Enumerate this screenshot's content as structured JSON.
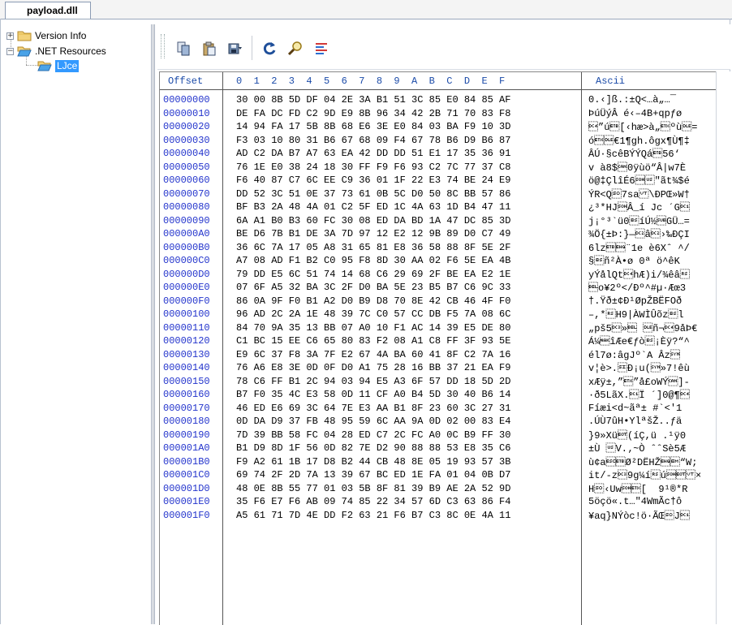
{
  "tab": {
    "title": "payload.dll"
  },
  "tree": {
    "items": [
      {
        "label": "Version Info",
        "expander": "+"
      },
      {
        "label": ".NET Resources",
        "expander": "−"
      },
      {
        "label": "LJce",
        "selected": true
      }
    ]
  },
  "toolbar": {
    "buttons": [
      "copy-icon",
      "paste-icon",
      "save-to-file-icon",
      "refresh-icon",
      "find-icon",
      "properties-icon"
    ]
  },
  "hex": {
    "header_offset": "Offset",
    "header_columns": "0  1  2  3  4  5  6  7  8  9  A  B  C  D  E  F",
    "header_ascii": "Ascii",
    "rows": [
      {
        "offset": "00000000",
        "bytes": "30 00 8B 5D DF 04 2E 3A B1 51 3C 85 E0 84 85 AF",
        "ascii": "0.‹]ß.:±Q<…à„…¯"
      },
      {
        "offset": "00000010",
        "bytes": "DE FA DC FD C2 9D E9 8B 96 34 42 2B 71 70 83 F8",
        "ascii": "ÞúÜýÂ é‹–4B+qpƒø"
      },
      {
        "offset": "00000020",
        "bytes": "14 94 FA 17 5B 8B 68 E6 3E E0 84 03 BA F9 10 3D",
        "ascii": "\u0014”ú\u0017[‹hæ>à„\u0003ºù\u0010="
      },
      {
        "offset": "00000030",
        "bytes": "F3 03 10 80 31 B6 67 68 09 F4 67 78 B6 D9 B6 87",
        "ascii": "ó\u0003\u0010€1¶gh.ôgx¶Ù¶‡"
      },
      {
        "offset": "00000040",
        "bytes": "AD C2 DA B7 A7 63 EA 42 DD DD 51 E1 17 35 36 91",
        "ascii": "­ÂÚ·§cêBÝÝQá\u001756‘"
      },
      {
        "offset": "00000050",
        "bytes": "76 1E E0 38 24 18 30 FF F9 F6 93 C2 7C 77 37 C8",
        "ascii": "v à8$\u00180ÿùö“Â|w7È"
      },
      {
        "offset": "00000060",
        "bytes": "F6 40 87 C7 6C EE C9 36 01 1F 22 E3 74 BE 24 E9",
        "ascii": "ö@‡ÇlîÉ6\u0001\u001f\"ãt¾$é"
      },
      {
        "offset": "00000070",
        "bytes": "DD 52 3C 51 0E 37 73 61 0B 5C D0 50 8C BB 57 86",
        "ascii": "ÝR<Q\u000e7sa\u000b\\ÐPŒ»W†"
      },
      {
        "offset": "00000080",
        "bytes": "BF B3 2A 48 4A 01 C2 5F ED 1C 4A 63 1D B4 47 11",
        "ascii": "¿³*HJ\u0001Â_í Jc ´G\u0011"
      },
      {
        "offset": "00000090",
        "bytes": "6A A1 B0 B3 60 FC 30 08 ED DA BD 1A 47 DC 85 3D",
        "ascii": "j¡°³`ü0\bíÚ½\u001aGÜ…="
      },
      {
        "offset": "000000A0",
        "bytes": "BE D6 7B B1 DE 3A 7D 97 12 E2 12 9B 89 D0 C7 49",
        "ascii": "¾Ö{±Þ:}—\u0012â\u0012›‰ÐÇI"
      },
      {
        "offset": "000000B0",
        "bytes": "36 6C 7A 17 05 A8 31 65 81 E8 36 58 88 8F 5E 2F",
        "ascii": "6lz\u0017\u0005¨1e è6Xˆ ^/"
      },
      {
        "offset": "000000C0",
        "bytes": "A7 08 AD F1 B2 C0 95 F8 8D 30 AA 02 F6 5E EA 4B",
        "ascii": "§\b­ñ²À•ø 0ª ö^êK"
      },
      {
        "offset": "000000D0",
        "bytes": "79 DD E5 6C 51 74 14 68 C6 29 69 2F BE EA E2 1E",
        "ascii": "yÝålQt\u0014hÆ)i/¾êâ\u001e"
      },
      {
        "offset": "000000E0",
        "bytes": "07 6F A5 32 BA 3C 2F D0 BA 5E 23 B5 B7 C6 9C 33",
        "ascii": "\u0007o¥2º</Ðº^#µ·Æœ3"
      },
      {
        "offset": "000000F0",
        "bytes": "86 0A 9F F0 B1 A2 D0 B9 D8 70 8E 42 CB 46 4F F0",
        "ascii": "†.Ÿð±¢Ð¹ØpŽBËFOð"
      },
      {
        "offset": "00000100",
        "bytes": "96 AD 2C 2A 1E 48 39 7C C0 57 CC DB F5 7A 08 6C",
        "ascii": "–­,*\u001eH9|ÀWÌÛõz\bl"
      },
      {
        "offset": "00000110",
        "bytes": "84 70 9A 35 13 BB 07 A0 10 F1 AC 14 39 E5 DE 80",
        "ascii": "„pš5\u0013»\u0007 \u0010ñ¬\u00149åÞ€"
      },
      {
        "offset": "00000120",
        "bytes": "C1 BC 15 EE C6 65 80 83 F2 08 A1 C8 FF 3F 93 5E",
        "ascii": "Á¼\u0015îÆe€ƒò\b¡Èÿ?“^"
      },
      {
        "offset": "00000130",
        "bytes": "E9 6C 37 F8 3A 7F E2 67 4A BA 60 41 8F C2 7A 16",
        "ascii": "él7ø:âgJº`A Âz\u0016"
      },
      {
        "offset": "00000140",
        "bytes": "76 A6 E8 3E 0D 0F D0 A1 75 28 16 BB 37 21 EA F9",
        "ascii": "v¦è>.\u000fÐ¡u(\u0016»7!êù"
      },
      {
        "offset": "00000150",
        "bytes": "78 C6 FF B1 2C 94 03 94 E5 A3 6F 57 DD 18 5D 2D",
        "ascii": "xÆÿ±,”\u0003”å£oWÝ\u0018]-"
      },
      {
        "offset": "00000160",
        "bytes": "B7 F0 35 4C E3 58 0D 11 CF A0 B4 5D 30 40 B6 14",
        "ascii": "·ð5LãX.\u0011Ï ´]0@¶\u0014"
      },
      {
        "offset": "00000170",
        "bytes": "46 ED E6 69 3C 64 7E E3 AA B1 8F 23 60 3C 27 31",
        "ascii": "Fíæi<d~ãª± #`<'1"
      },
      {
        "offset": "00000180",
        "bytes": "0D DA D9 37 FB 48 95 59 6C AA 9A 0D 02 00 83 E4",
        "ascii": ".ÚÙ7ûH•YlªšŽ..ƒä"
      },
      {
        "offset": "00000190",
        "bytes": "7D 39 BB 58 FC 04 28 ED C7 2C FC A0 0C B9 FF 30",
        "ascii": "}9»Xü\u0004(íÇ,ü .¹ÿ0"
      },
      {
        "offset": "000001A0",
        "bytes": "B1 D9 8D 1F 56 0D 82 7E D2 90 88 88 53 E8 35 C6",
        "ascii": "±Ù \u001fV.‚~Ò ˆˆSè5Æ"
      },
      {
        "offset": "000001B0",
        "bytes": "F9 A2 61 1B 17 D8 B2 44 CB 48 8E 05 19 93 57 3B",
        "ascii": "ù¢a\u001b\u0017Ø²DËHŽ\u0005\u0019“W;"
      },
      {
        "offset": "000001C0",
        "bytes": "69 74 2F 2D 7A 13 39 67 BC ED 1E FA 01 04 0B D7",
        "ascii": "it/-z\u00139g¼í\u001eú\u0001\u0004\u000b×"
      },
      {
        "offset": "000001D0",
        "bytes": "48 0E 8B 55 77 01 03 5B 8F 81 39 B9 AE 2A 52 9D",
        "ascii": "H\u000e‹Uw\u0001\u0003[  9¹®*R "
      },
      {
        "offset": "000001E0",
        "bytes": "35 F6 E7 F6 AB 09 74 85 22 34 57 6D C3 63 86 F4",
        "ascii": "5öçö«.t…\"4WmÃc†ô"
      },
      {
        "offset": "000001F0",
        "bytes": "A5 61 71 7D 4E DD F2 63 21 F6 B7 C3 8C 0E 4A 11",
        "ascii": "¥aq}NÝòc!ö·ÃŒ\u000eJ\u0011"
      }
    ]
  }
}
